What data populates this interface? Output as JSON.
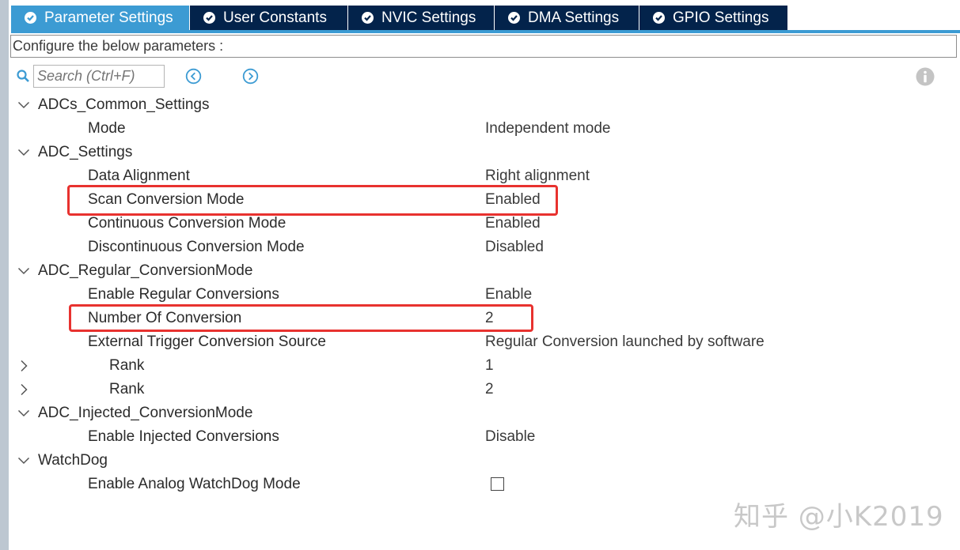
{
  "tabs": [
    {
      "label": "Parameter Settings",
      "active": true
    },
    {
      "label": "User Constants",
      "active": false
    },
    {
      "label": "NVIC Settings",
      "active": false
    },
    {
      "label": "DMA Settings",
      "active": false
    },
    {
      "label": "GPIO Settings",
      "active": false
    }
  ],
  "configure_text": "Configure the below parameters :",
  "search": {
    "placeholder": "Search (Ctrl+F)"
  },
  "tree": {
    "groups": {
      "adcs_common": "ADCs_Common_Settings",
      "adc_settings": "ADC_Settings",
      "regular": "ADC_Regular_ConversionMode",
      "injected": "ADC_Injected_ConversionMode",
      "watchdog": "WatchDog"
    },
    "params": {
      "mode": {
        "name": "Mode",
        "value": "Independent mode"
      },
      "data_alignment": {
        "name": "Data Alignment",
        "value": "Right alignment"
      },
      "scan_conversion": {
        "name": "Scan Conversion Mode",
        "value": "Enabled"
      },
      "continuous_conversion": {
        "name": "Continuous Conversion Mode",
        "value": "Enabled"
      },
      "discontinuous_conversion": {
        "name": "Discontinuous Conversion Mode",
        "value": "Disabled"
      },
      "enable_regular": {
        "name": "Enable Regular Conversions",
        "value": "Enable"
      },
      "number_of_conversion": {
        "name": "Number Of Conversion",
        "value": "2"
      },
      "external_trigger": {
        "name": "External Trigger Conversion Source",
        "value": "Regular Conversion launched by software"
      },
      "rank1": {
        "name": "Rank",
        "value": "1"
      },
      "rank2": {
        "name": "Rank",
        "value": "2"
      },
      "enable_injected": {
        "name": "Enable Injected Conversions",
        "value": "Disable"
      },
      "analog_watchdog": {
        "name": "Enable Analog WatchDog Mode",
        "checked": false
      }
    }
  },
  "watermark": "知乎 @小K2019",
  "colors": {
    "tab_active": "#3c9bd3",
    "tab_inactive": "#03234b",
    "highlight": "#e8322f",
    "nav_icon": "#3c9bd3"
  },
  "icons": {
    "tab_status": "check-circle-icon",
    "search": "search-icon",
    "previous": "arrow-left-circle-icon",
    "next": "arrow-right-circle-icon",
    "info": "info-icon",
    "expanded": "chevron-down-icon",
    "collapsed": "chevron-right-icon"
  }
}
